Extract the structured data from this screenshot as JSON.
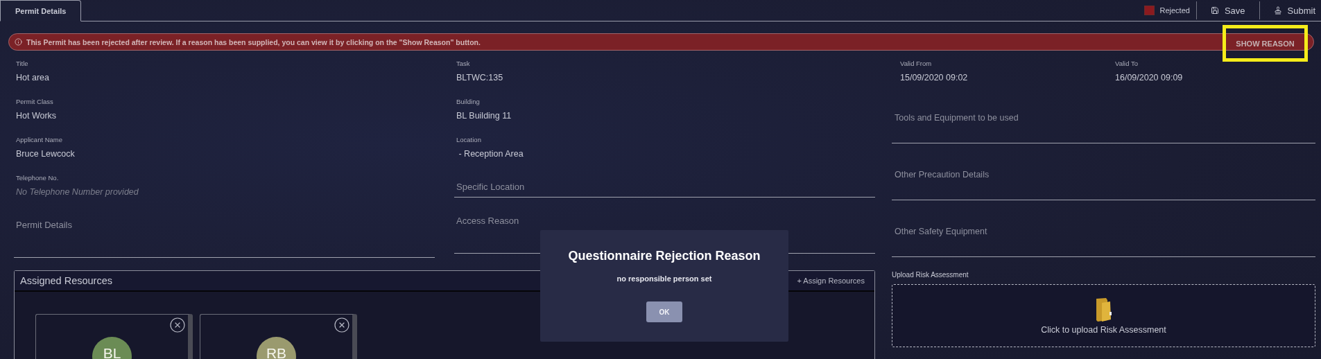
{
  "tabs": [
    {
      "label": "Permit Details",
      "selected": true
    }
  ],
  "toolbar": {
    "status": {
      "label": "Rejected",
      "color": "#8b1a1f"
    },
    "buttons": [
      {
        "label": "Save",
        "kind": "save"
      },
      {
        "label": "Submit",
        "kind": "submit"
      }
    ]
  },
  "banner": {
    "message": "This Permit has been rejected after review. If a reason has been supplied, you can view it by clicking on the \"Show Reason\" button.",
    "action": "SHOW REASON",
    "highlighted": true
  },
  "details_left": [
    {
      "label": "Title",
      "value": "Hot area",
      "empty": false
    },
    {
      "label": "Permit Class",
      "value": "Hot Works",
      "empty": false
    },
    {
      "label": "Applicant Name",
      "value": "Bruce Lewcock",
      "empty": false
    },
    {
      "label": "Telephone No.",
      "value": "No Telephone Number provided",
      "empty": true
    }
  ],
  "details_middle": [
    {
      "label": "Task",
      "value": "BLTWC:135",
      "empty": false
    },
    {
      "label": "Building",
      "value": "BL Building 11",
      "empty": false
    },
    {
      "label": "Location",
      "value": " - Reception Area",
      "empty": false
    }
  ],
  "left_fields": [
    {
      "placeholder": "Permit Details",
      "kind": "tall"
    }
  ],
  "middle_fields": [
    {
      "placeholder": "Specific Location",
      "kind": "short"
    },
    {
      "placeholder": "Access Reason",
      "kind": "tall"
    }
  ],
  "validity": [
    {
      "label": "Valid From",
      "value": "15/09/2020 09:02"
    },
    {
      "label": "Valid To",
      "value": "16/09/2020 09:09"
    }
  ],
  "right_fields": [
    {
      "placeholder": "Tools and Equipment to be used",
      "kind": "tall"
    },
    {
      "placeholder": "Other Precaution Details",
      "kind": "tall"
    },
    {
      "placeholder": "Other Safety Equipment",
      "kind": "tall"
    }
  ],
  "upload": {
    "label": "Upload Risk Assessment",
    "prompt": "Click to upload Risk Assessment"
  },
  "assigned_resources": {
    "title": "Assigned Resources",
    "action": "+ Assign Resources",
    "resources": [
      {
        "initials": "BL",
        "color": "#6b8c55"
      },
      {
        "initials": "RB",
        "color": "#9a9a6e"
      }
    ]
  },
  "dialog": {
    "title": "Questionnaire Rejection Reason",
    "message": "no responsible person set",
    "button": "OK"
  }
}
